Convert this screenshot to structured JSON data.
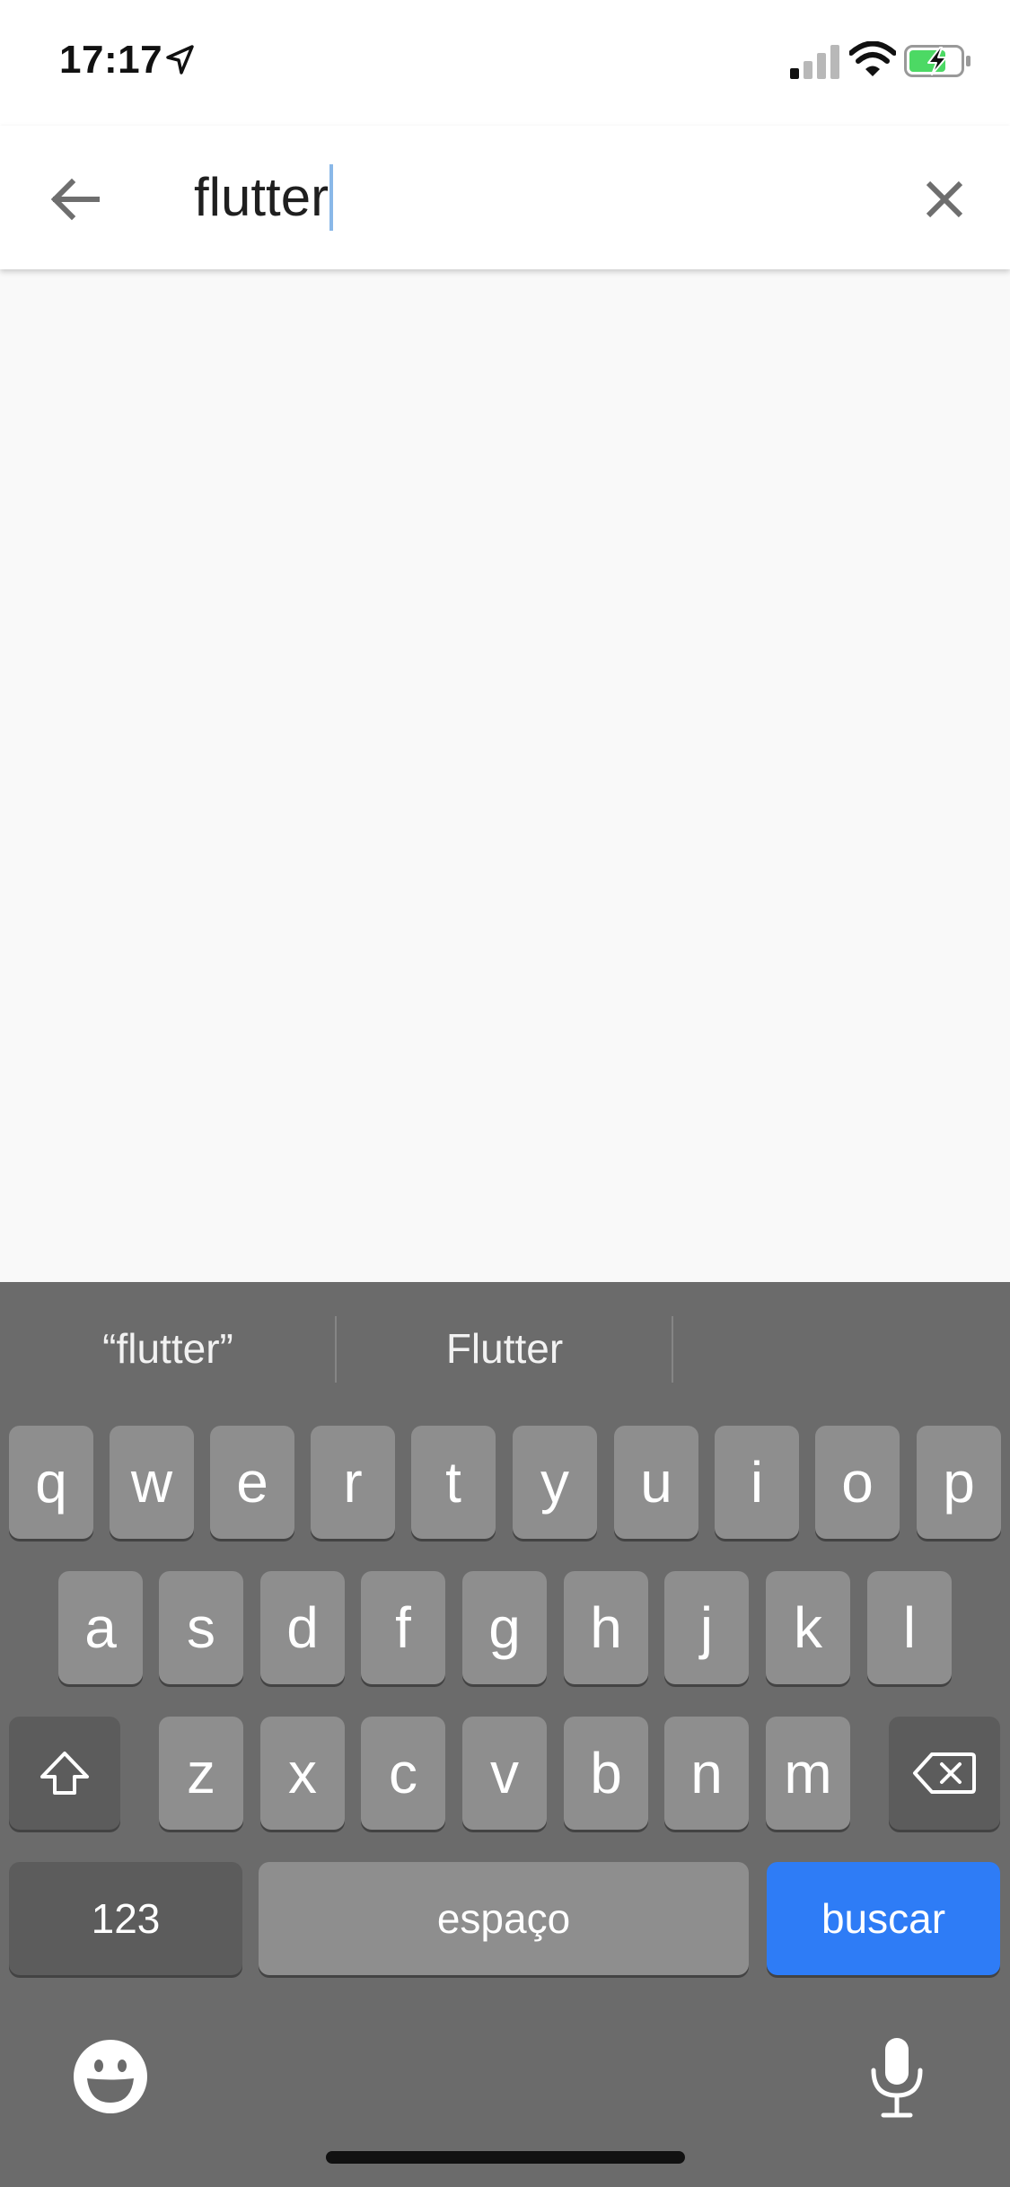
{
  "status_bar": {
    "time": "17:17",
    "icons": [
      "location-arrow-icon",
      "cellular-signal-icon",
      "wifi-icon",
      "battery-charging-icon"
    ],
    "battery_color": "#4cd964"
  },
  "search": {
    "value": "flutter",
    "back_icon": "arrow-left-icon",
    "clear_icon": "close-icon",
    "cursor_color": "#8ab8e8"
  },
  "keyboard": {
    "suggestions": [
      "“flutter”",
      "Flutter",
      ""
    ],
    "row1": [
      "q",
      "w",
      "e",
      "r",
      "t",
      "y",
      "u",
      "i",
      "o",
      "p"
    ],
    "row2": [
      "a",
      "s",
      "d",
      "f",
      "g",
      "h",
      "j",
      "k",
      "l"
    ],
    "row3": [
      "z",
      "x",
      "c",
      "v",
      "b",
      "n",
      "m"
    ],
    "numbers_label": "123",
    "space_label": "espaço",
    "action_label": "buscar",
    "action_color": "#2e7cf6",
    "shift_icon": "shift-icon",
    "backspace_icon": "backspace-icon",
    "emoji_icon": "emoji-icon",
    "mic_icon": "microphone-icon"
  }
}
